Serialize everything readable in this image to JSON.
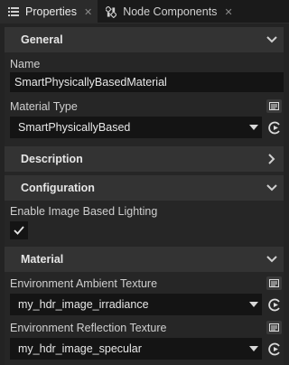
{
  "tabs": [
    {
      "label": "Properties",
      "icon": "list-icon",
      "active": true
    },
    {
      "label": "Node Components",
      "icon": "components-icon",
      "active": false
    }
  ],
  "sections": {
    "general": {
      "title": "General",
      "expanded": true
    },
    "description": {
      "title": "Description",
      "expanded": false
    },
    "configuration": {
      "title": "Configuration",
      "expanded": true
    },
    "material": {
      "title": "Material",
      "expanded": true
    }
  },
  "fields": {
    "name": {
      "label": "Name",
      "value": "SmartPhysicallyBasedMaterial"
    },
    "material_type": {
      "label": "Material Type",
      "value": "SmartPhysicallyBased"
    },
    "ibl": {
      "label": "Enable Image Based Lighting",
      "checked": true
    },
    "ambient_texture": {
      "label": "Environment Ambient Texture",
      "value": "my_hdr_image_irradiance"
    },
    "reflection_texture": {
      "label": "Environment Reflection Texture",
      "value": "my_hdr_image_specular"
    }
  },
  "colors": {
    "background": "#232323",
    "section_header": "#333333",
    "field": "#141414"
  }
}
